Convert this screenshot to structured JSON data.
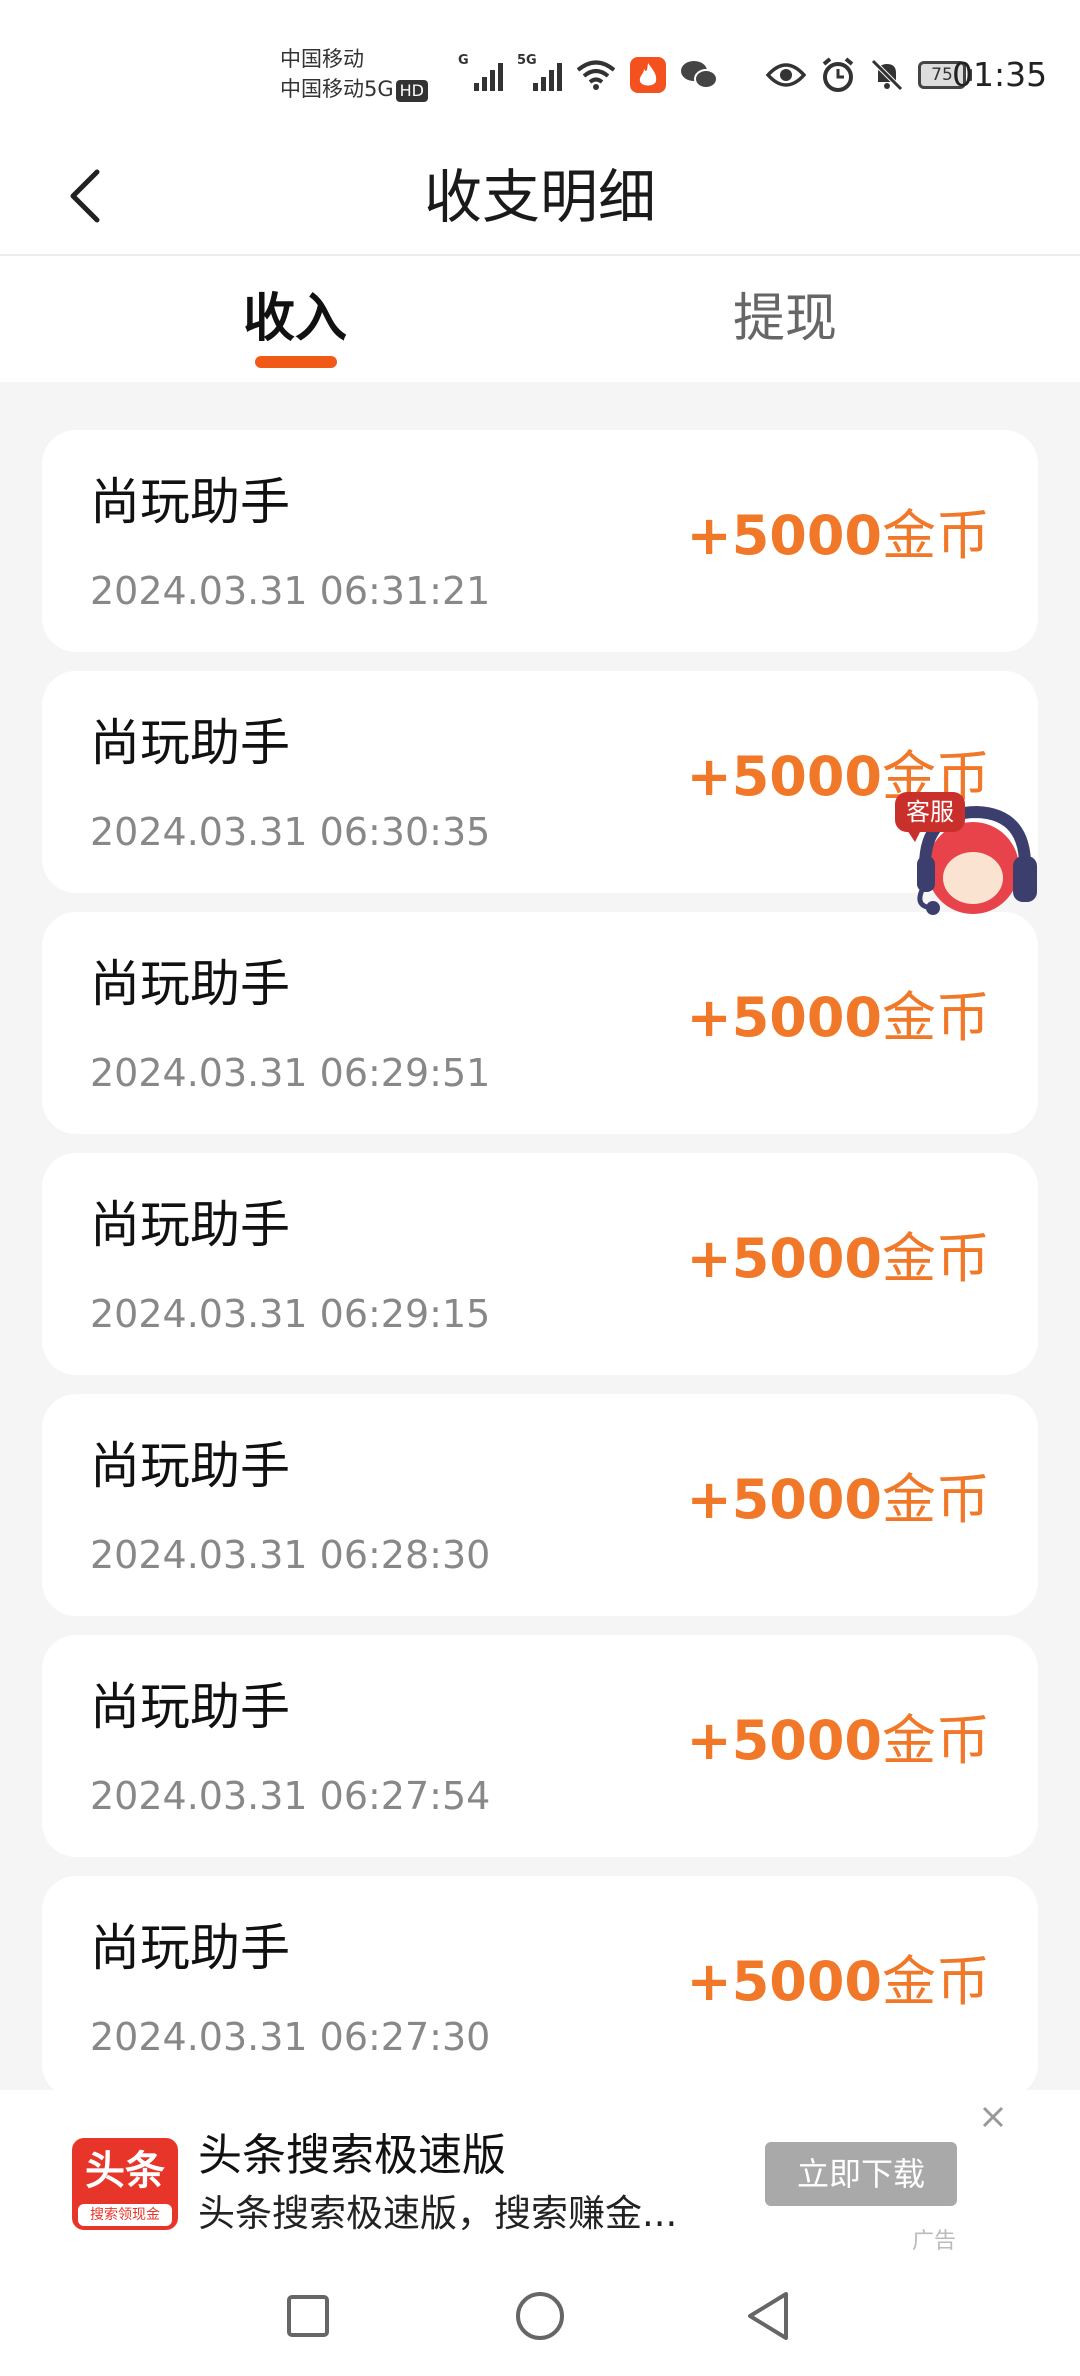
{
  "status_bar": {
    "carrier_line1": "中国移动",
    "carrier_line2": "中国移动5G",
    "hd_badge": "HD",
    "signal1_label": "G",
    "signal2_label": "5G",
    "battery_level": "75",
    "time": "01:35",
    "icons": [
      "signal-icon",
      "signal-5g-icon",
      "wifi-icon",
      "hot-app-icon",
      "wechat-icon",
      "eye-icon",
      "alarm-icon",
      "mute-icon",
      "battery-icon"
    ]
  },
  "header": {
    "title": "收支明细",
    "back_icon": "chevron-left-icon"
  },
  "tabs": [
    {
      "label": "收入",
      "active": true
    },
    {
      "label": "提现",
      "active": false
    }
  ],
  "records": [
    {
      "source": "尚玩助手",
      "time": "2024.03.31 06:31:21",
      "amount": "+5000",
      "unit": "金币"
    },
    {
      "source": "尚玩助手",
      "time": "2024.03.31 06:30:35",
      "amount": "+5000",
      "unit": "金币"
    },
    {
      "source": "尚玩助手",
      "time": "2024.03.31 06:29:51",
      "amount": "+5000",
      "unit": "金币"
    },
    {
      "source": "尚玩助手",
      "time": "2024.03.31 06:29:15",
      "amount": "+5000",
      "unit": "金币"
    },
    {
      "source": "尚玩助手",
      "time": "2024.03.31 06:28:30",
      "amount": "+5000",
      "unit": "金币"
    },
    {
      "source": "尚玩助手",
      "time": "2024.03.31 06:27:54",
      "amount": "+5000",
      "unit": "金币"
    },
    {
      "source": "尚玩助手",
      "time": "2024.03.31 06:27:30",
      "amount": "+5000",
      "unit": "金币"
    }
  ],
  "customer_service": {
    "label": "客服"
  },
  "ad": {
    "logo_text": "头条",
    "logo_sub": "搜索领现金",
    "title": "头条搜索极速版",
    "description": "头条搜索极速版，搜索赚金...",
    "button": "立即下载",
    "tag": "广告"
  },
  "colors": {
    "accent": "#f05a16",
    "amount": "#f07828",
    "background": "#f5f5f5"
  }
}
